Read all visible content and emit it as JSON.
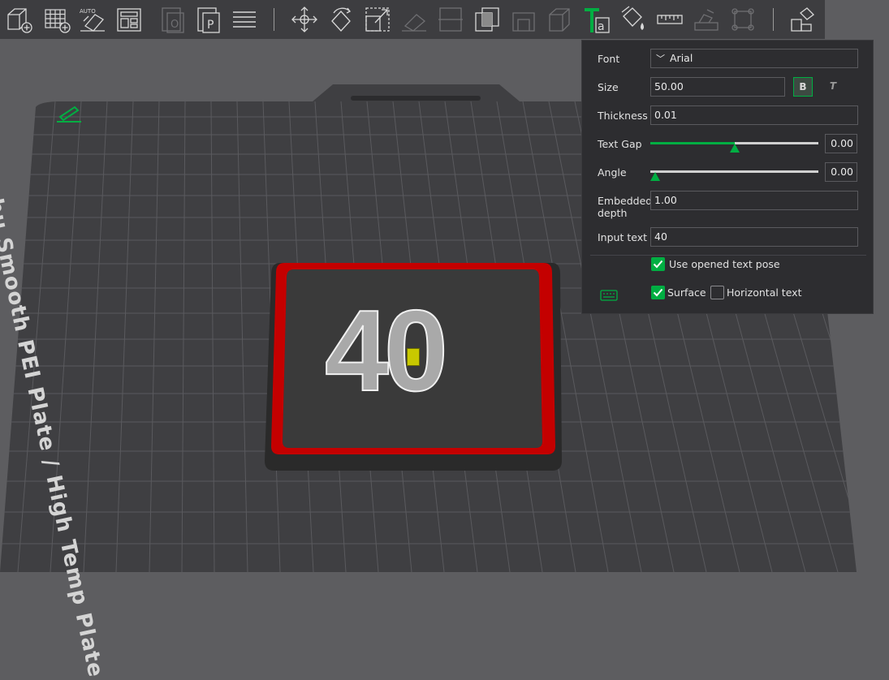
{
  "toolbar": {
    "icons": [
      "add-object-icon",
      "add-plate-icon",
      "auto-orient-icon",
      "arrange-icon",
      "split-objects-icon",
      "split-parts-icon",
      "layers-icon",
      "move-icon",
      "rotate-icon",
      "scale-icon",
      "lay-on-face-icon",
      "cut-icon",
      "boolean-icon",
      "support-paint-icon",
      "seam-paint-icon",
      "text-tool-icon",
      "color-paint-icon",
      "measure-icon",
      "assembly-icon",
      "brim-ears-icon",
      "assembly-view-icon"
    ]
  },
  "scene": {
    "plate_name": "Bambu Smooth PEI Plate / High Temp Plate",
    "model_text": "40"
  },
  "panel": {
    "font_label": "Font",
    "font_value": "Arial",
    "size_label": "Size",
    "size_value": "50.00",
    "bold_label": "B",
    "italic_label": "T",
    "thickness_label": "Thickness",
    "thickness_value": "0.01",
    "text_gap_label": "Text Gap",
    "text_gap_value": "0.00",
    "text_gap_fraction": 0.5,
    "angle_label": "Angle",
    "angle_value": "0.00",
    "angle_fraction": 0.0,
    "embedded_label_1": "Embedded",
    "embedded_label_2": "depth",
    "embedded_value": "1.00",
    "input_text_label": "Input text",
    "input_text_value": "40",
    "use_pose_label": "Use opened text pose",
    "use_pose_checked": true,
    "surface_label": "Surface",
    "surface_checked": true,
    "horizontal_label": "Horizontal text",
    "horizontal_checked": false
  },
  "colors": {
    "accent": "#00ae42",
    "panel_bg": "#2d2d30",
    "toolbar_bg": "#3d3d40",
    "model_rim": "#c40000",
    "model_top": "#3a3a3a",
    "text_fill": "#a9a9a9"
  }
}
